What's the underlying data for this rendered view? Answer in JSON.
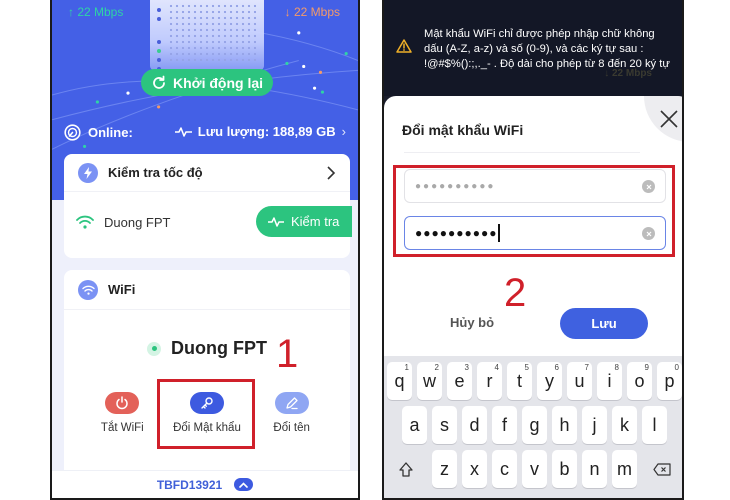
{
  "left_screen": {
    "upload_speed": "↑ 22 Mbps",
    "download_speed": "↓ 22 Mbps",
    "restart_label": "Khởi động lại",
    "status_label": "Online:",
    "usage_label": "Lưu lượng: 188,89 GB",
    "speed_test": {
      "title": "Kiểm tra tốc độ",
      "network_name": "Duong FPT",
      "check_label": "Kiểm tra"
    },
    "wifi_card": {
      "title": "WiFi",
      "ssid": "Duong FPT",
      "actions": [
        {
          "label": "Tắt WiFi",
          "icon": "power-icon",
          "color": "#e36159"
        },
        {
          "label": "Đổi Mật khẩu",
          "icon": "key-icon",
          "color": "#3d5ae0"
        },
        {
          "label": "Đổi tên",
          "icon": "pencil-icon",
          "color": "#8fa6f3"
        }
      ]
    },
    "device_code": "TBFD13921",
    "step_number": "1"
  },
  "right_screen": {
    "toast_message": "Mật khẩu WiFi chỉ được phép nhập chữ không dấu (A-Z, a-z) và số (0-9), và các ký tự sau : !@#$%():;,._- . Độ dài cho phép từ 8 đến 20 ký tự",
    "toast_background_text": "↓ 22 Mbps",
    "dialog_title": "Đổi mật khẩu WiFi",
    "old_password_value": "●●●●●●●●●●",
    "new_password_value": "●●●●●●●●●●",
    "cancel_label": "Hủy bỏ",
    "save_label": "Lưu",
    "step_number": "2",
    "keyboard": {
      "row1": [
        {
          "key": "q",
          "hint": "1"
        },
        {
          "key": "w",
          "hint": "2"
        },
        {
          "key": "e",
          "hint": "3"
        },
        {
          "key": "r",
          "hint": "4"
        },
        {
          "key": "t",
          "hint": "5"
        },
        {
          "key": "y",
          "hint": "6"
        },
        {
          "key": "u",
          "hint": "7"
        },
        {
          "key": "i",
          "hint": "8"
        },
        {
          "key": "o",
          "hint": "9"
        },
        {
          "key": "p",
          "hint": "0"
        }
      ],
      "row2": [
        "a",
        "s",
        "d",
        "f",
        "g",
        "h",
        "j",
        "k",
        "l"
      ],
      "row3": [
        "z",
        "x",
        "c",
        "v",
        "b",
        "n",
        "m"
      ]
    }
  },
  "colors": {
    "primary_blue": "#4460e6",
    "accent_green": "#2cc47f",
    "annotation_red": "#d0202a"
  }
}
